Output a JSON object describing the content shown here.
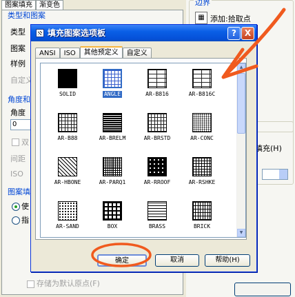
{
  "background": {
    "tabs": [
      "图案填充",
      "渐变色"
    ],
    "groups": {
      "type_pattern": "类型和图案",
      "angle_scale": "角度和",
      "origin": "图案填"
    },
    "labels": {
      "type": "类型",
      "pattern": "图案",
      "swatch": "样例",
      "custom": "自定义",
      "angle": "角度",
      "double": "双",
      "spacing": "间距",
      "iso": "ISO",
      "use": "使",
      "specified": "指"
    },
    "angle_value": "0",
    "store_default_origin": "存储为默认原点(F)",
    "right": {
      "boundaries_title": "边界",
      "add_pick_points": "添加:拾取点",
      "fill_label": "填充(H)"
    }
  },
  "dialog": {
    "title": "填充图案选项板",
    "help_glyph": "?",
    "close_glyph": "X",
    "tabs": [
      "ANSI",
      "ISO",
      "其他预定义",
      "自定义"
    ],
    "active_tab": "其他预定义",
    "patterns": [
      "SOLID",
      "ANGLE",
      "AR-B816",
      "AR-B816C",
      "AR-B88",
      "AR-BRELM",
      "AR-BRSTD",
      "AR-CONC",
      "AR-HBONE",
      "AR-PARQ1",
      "AR-RROOF",
      "AR-RSHKE",
      "AR-SAND",
      "BOX",
      "BRASS",
      "BRICK"
    ],
    "selected_pattern": "ANGLE",
    "buttons": {
      "ok": "确定",
      "cancel": "取消",
      "help": "帮助(H)"
    }
  },
  "colors": {
    "title_bar": "#0a5fe6",
    "selection": "#316ac5",
    "annotation": "#f05a1e"
  }
}
